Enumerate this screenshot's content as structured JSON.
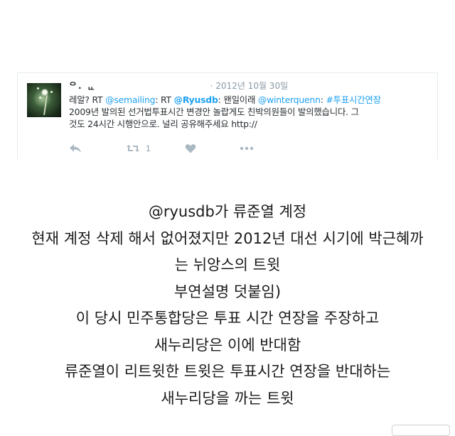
{
  "tweet": {
    "display_name": "ᄋ. ᆫᆫ",
    "date": "· 2012년 10월 30일",
    "text": {
      "line1": {
        "part1": "레알? RT ",
        "mention1": "@semailing",
        "part2": ": RT ",
        "mention2": "@Ryusdb",
        "part3": ": 왠일이래 ",
        "mention3": "@winterquenn",
        "part4": ": ",
        "hashtag": "#투표시간연장"
      },
      "line2": "2009년 발의된 선거법투표시간 변경안 놀랍게도 친박의원들이 발의했습니다. 그",
      "line3": "것도 24시간 시행안으로. 널리 공유해주세요 http://"
    },
    "retweet_count": "1",
    "icons": {
      "reply": "reply-icon",
      "retweet": "retweet-icon",
      "like": "heart-icon",
      "more": "more-icon"
    },
    "colors": {
      "link": "#1da1f2",
      "text": "#292f33",
      "muted": "#aab8c2"
    }
  },
  "caption": {
    "line1": "@ryusdb가 류준열 계정",
    "line2": "현재 계정 삭제 해서 없어졌지만 2012년 대선 시기에 박근혜까",
    "line3": "는 뉘앙스의 트윗",
    "line4": "부연설명 덧붙임)",
    "line5": "이 당시 민주통합당은 투표 시간 연장을 주장하고",
    "line6": "새누리당은 이에 반대함",
    "line7": "류준열이 리트윗한 트윗은 투표시간 연장을 반대하는",
    "line8": "새누리당을 까는 트윗"
  }
}
